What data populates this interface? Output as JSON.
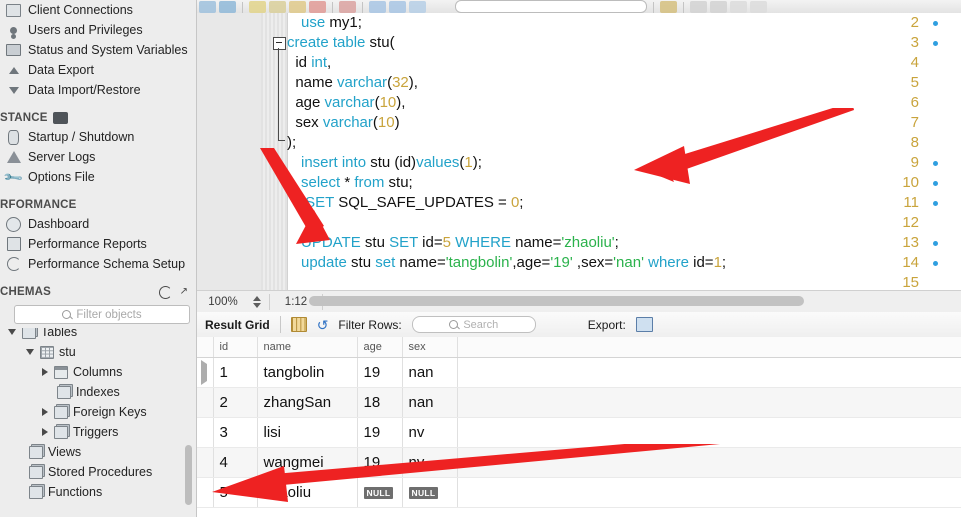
{
  "sidebar": {
    "management_items": [
      {
        "label": "Client Connections",
        "icon": "connections-icon"
      },
      {
        "label": "Users and Privileges",
        "icon": "user-icon"
      },
      {
        "label": "Status and System Variables",
        "icon": "monitor-icon"
      },
      {
        "label": "Data Export",
        "icon": "export-icon"
      },
      {
        "label": "Data Import/Restore",
        "icon": "import-icon"
      }
    ],
    "instance_header": "STANCE",
    "instance_items": [
      {
        "label": "Startup / Shutdown",
        "icon": "server-icon"
      },
      {
        "label": "Server Logs",
        "icon": "warning-icon"
      },
      {
        "label": "Options File",
        "icon": "wrench-icon"
      }
    ],
    "performance_header": "RFORMANCE",
    "performance_items": [
      {
        "label": "Dashboard",
        "icon": "dashboard-icon"
      },
      {
        "label": "Performance Reports",
        "icon": "report-icon"
      },
      {
        "label": "Performance Schema Setup",
        "icon": "schema-setup-icon"
      }
    ],
    "schemas_header": "CHEMAS",
    "filter_placeholder": "Filter objects",
    "tree": [
      {
        "label": "Tables",
        "indent": 0,
        "twisty": "down",
        "icon": "table-group-icon"
      },
      {
        "label": "stu",
        "indent": 1,
        "twisty": "down",
        "icon": "table-icon"
      },
      {
        "label": "Columns",
        "indent": 2,
        "twisty": "right",
        "icon": "columns-icon"
      },
      {
        "label": "Indexes",
        "indent": 2,
        "twisty": "none",
        "icon": "indexes-icon"
      },
      {
        "label": "Foreign Keys",
        "indent": 2,
        "twisty": "right",
        "icon": "foreign-keys-icon"
      },
      {
        "label": "Triggers",
        "indent": 2,
        "twisty": "right",
        "icon": "triggers-icon"
      },
      {
        "label": "Views",
        "indent": 0,
        "twisty": "none",
        "icon": "views-icon"
      },
      {
        "label": "Stored Procedures",
        "indent": 0,
        "twisty": "none",
        "icon": "stored-procedures-icon"
      },
      {
        "label": "Functions",
        "indent": 0,
        "twisty": "none",
        "icon": "functions-icon"
      }
    ]
  },
  "editor": {
    "lines": [
      {
        "number": "2",
        "breakpoint": true
      },
      {
        "number": "3",
        "breakpoint": true
      },
      {
        "number": "4",
        "breakpoint": false
      },
      {
        "number": "5",
        "breakpoint": false
      },
      {
        "number": "6",
        "breakpoint": false
      },
      {
        "number": "7",
        "breakpoint": false
      },
      {
        "number": "8",
        "breakpoint": false
      },
      {
        "number": "9",
        "breakpoint": true
      },
      {
        "number": "10",
        "breakpoint": true
      },
      {
        "number": "11",
        "breakpoint": true
      },
      {
        "number": "12",
        "breakpoint": false
      },
      {
        "number": "13",
        "breakpoint": true
      },
      {
        "number": "14",
        "breakpoint": true
      },
      {
        "number": "15",
        "breakpoint": false
      }
    ],
    "code": {
      "l2_kw": "use",
      "l2_rest": " my1;",
      "l3_kw": "create table",
      "l3_rest": " stu(",
      "l4_name": "  id ",
      "l4_type": "int",
      "l4_tail": ",",
      "l5_name": "  name ",
      "l5_type": "varchar",
      "l5_open": "(",
      "l5_num": "32",
      "l5_tail": "),",
      "l6_name": "  age ",
      "l6_type": "varchar",
      "l6_open": "(",
      "l6_num": "10",
      "l6_tail": "),",
      "l7_name": "  sex ",
      "l7_type": "varchar",
      "l7_open": "(",
      "l7_num": "10",
      "l7_tail": ")",
      "l8": ");",
      "l9_kw": "insert into",
      "l9_mid": " stu (id)",
      "l9_kw2": "values",
      "l9_open": "(",
      "l9_num": "1",
      "l9_tail": ");",
      "l10_kw": "select",
      "l10_star": " * ",
      "l10_kw2": "from",
      "l10_tail": " stu;",
      "l11_kw": " SET",
      "l11_mid": " SQL_SAFE_UPDATES = ",
      "l11_num": "0",
      "l11_tail": ";",
      "l13_kw": "UPDATE",
      "l13_tbl": " stu ",
      "l13_kw2": "SET",
      "l13_col": " id=",
      "l13_num": "5",
      "l13_kw3": " WHERE",
      "l13_col2": " name=",
      "l13_str": "'zhaoliu'",
      "l13_tail": ";",
      "l14_kw": "update",
      "l14_tbl": " stu ",
      "l14_kw2": "set",
      "l14_col": " name=",
      "l14_str": "'tangbolin'",
      "l14_col2": ",age=",
      "l14_str2": "'19'",
      "l14_col3": " ,sex=",
      "l14_str3": "'nan'",
      "l14_kw3": " where",
      "l14_col4": " id=",
      "l14_num": "1",
      "l14_tail": ";"
    }
  },
  "status_bar": {
    "zoom": "100%",
    "caret_position": "1:12"
  },
  "result_toolbar": {
    "title": "Result Grid",
    "filter_label": "Filter Rows:",
    "search_placeholder": "Search",
    "export_label": "Export:"
  },
  "result_grid": {
    "columns": [
      "id",
      "name",
      "age",
      "sex"
    ],
    "rows": [
      {
        "id": "1",
        "name": "tangbolin",
        "age": "19",
        "sex": "nan",
        "selected": true
      },
      {
        "id": "2",
        "name": "zhangSan",
        "age": "18",
        "sex": "nan",
        "selected": false
      },
      {
        "id": "3",
        "name": "lisi",
        "age": "19",
        "sex": "nv",
        "selected": false
      },
      {
        "id": "4",
        "name": "wangmei",
        "age": "19",
        "sex": "nv",
        "selected": false
      },
      {
        "id": "5",
        "name": "zhaoliu",
        "age": "NULL",
        "sex": "NULL",
        "selected": false
      }
    ],
    "null_label": "NULL"
  },
  "colors": {
    "keyword": "#22a2c9",
    "number": "#c9a43c",
    "string": "#2bb24c",
    "annotation_arrow": "#ee2222",
    "sidebar_bg": "#ededed"
  }
}
